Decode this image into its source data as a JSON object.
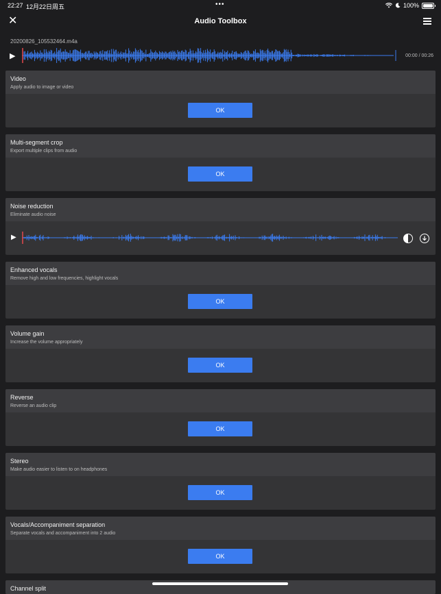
{
  "status": {
    "time": "22:27",
    "date": "12月22日周五",
    "battery": "100%"
  },
  "nav": {
    "title": "Audio Toolbox"
  },
  "player": {
    "filename": "20200826_105532464.m4a",
    "time": "00:00 / 00:26"
  },
  "colors": {
    "accent": "#3b7cf0",
    "waveform": "#3b7cf0",
    "playhead": "#e5484d",
    "card": "#343436",
    "card_header": "#3d3d40",
    "background": "#1d1d1f"
  },
  "tools": [
    {
      "name": "Video",
      "desc": "Apply audio to image or video",
      "button": "OK"
    },
    {
      "name": "Multi-segment crop",
      "desc": "Export multiple clips from audio",
      "button": "OK"
    },
    {
      "name": "Noise reduction",
      "desc": "Eliminate audio noise"
    },
    {
      "name": "Enhanced vocals",
      "desc": "Remove high and low frequencies, highlight vocals",
      "button": "OK"
    },
    {
      "name": "Volume gain",
      "desc": "Increase the volume appropriately",
      "button": "OK"
    },
    {
      "name": "Reverse",
      "desc": "Reverse an audio clip",
      "button": "OK"
    },
    {
      "name": "Stereo",
      "desc": "Make audio easier to listen to on headphones",
      "button": "OK"
    },
    {
      "name": "Vocals/Accompaniment separation",
      "desc": "Separate vocals and accompaniment into 2 audio",
      "button": "OK"
    },
    {
      "name": "Channel split"
    }
  ]
}
